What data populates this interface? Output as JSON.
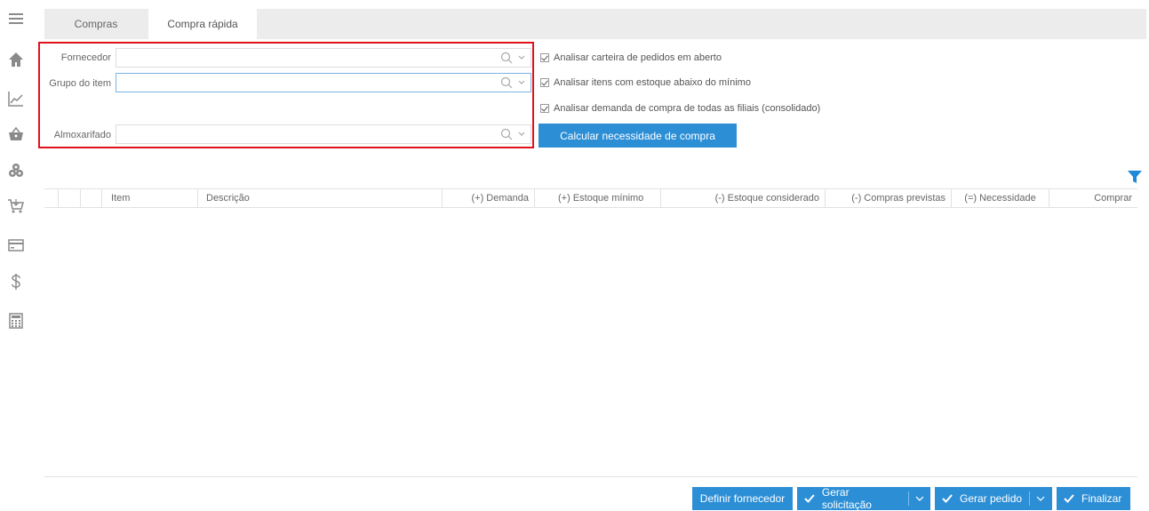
{
  "tabs": [
    {
      "label": "Compras"
    },
    {
      "label": "Compra rápida"
    }
  ],
  "filters": {
    "fornecedor_label": "Fornecedor",
    "grupo_label": "Grupo do item",
    "almoxarifado_label": "Almoxarifado",
    "fornecedor_value": "",
    "grupo_value": "",
    "almoxarifado_value": ""
  },
  "options": {
    "carteira_label": "Analisar carteira de pedidos em aberto",
    "estoque_label": "Analisar itens com estoque abaixo do mínimo",
    "demanda_label": "Analisar demanda de compra de todas as filiais (consolidado)"
  },
  "calc_button": "Calcular necessidade de compra",
  "grid": {
    "columns": [
      "Item",
      "Descrição",
      "(+) Demanda",
      "(+) Estoque mínimo",
      "(-) Estoque considerado",
      "(-) Compras previstas",
      "(=) Necessidade",
      "Comprar"
    ]
  },
  "actions": {
    "definir": "Definir fornecedor",
    "solicitacao": "Gerar solicitação",
    "pedido": "Gerar pedido",
    "finalizar": "Finalizar"
  },
  "icons": [
    "menu-icon",
    "home-icon",
    "chart-icon",
    "basket-icon",
    "boxes-icon",
    "cart-icon",
    "card-icon",
    "dollar-icon",
    "calculator-icon",
    "filter-icon",
    "search-icon",
    "chevron-down-icon",
    "check-icon"
  ],
  "colors": {
    "accent": "#2c8fd6",
    "highlight_border": "#e1121b",
    "filter_icon": "#1e88d9"
  }
}
